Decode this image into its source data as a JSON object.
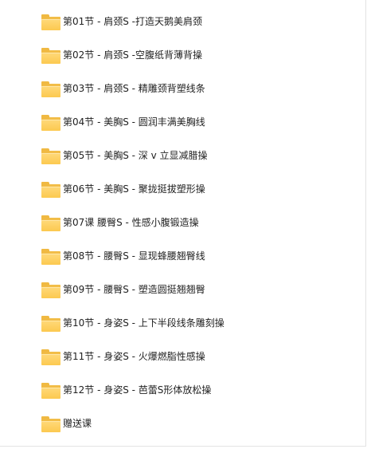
{
  "folders": [
    {
      "label": "第01节 - 肩颈S -打造天鹅美肩颈",
      "icon": "folder-icon"
    },
    {
      "label": "第02节 - 肩颈S -空腹纸背薄背操",
      "icon": "folder-icon"
    },
    {
      "label": "第03节 - 肩颈S - 精雕颈背塑线条",
      "icon": "folder-icon"
    },
    {
      "label": "第04节 - 美胸S - 圆润丰满美胸线",
      "icon": "folder-icon"
    },
    {
      "label": "第05节 - 美胸S - 深 v 立显减腊操",
      "icon": "folder-icon"
    },
    {
      "label": "第06节 - 美胸S - 聚拢挺拔塑形操",
      "icon": "folder-icon"
    },
    {
      "label": "第07课 腰臀S - 性感小腹锻造操",
      "icon": "folder-icon"
    },
    {
      "label": "第08节 - 腰臀S - 显现蜂腰翘臀线",
      "icon": "folder-icon"
    },
    {
      "label": "第09节 - 腰臀S - 塑造圆挺翘翘臀",
      "icon": "folder-icon"
    },
    {
      "label": "第10节 - 身姿S - 上下半段线条雕刻操",
      "icon": "folder-icon"
    },
    {
      "label": "第11节 - 身姿S - 火爆燃脂性感操",
      "icon": "folder-icon"
    },
    {
      "label": "第12节 - 身姿S - 芭蕾S形体放松操",
      "icon": "folder-icon"
    },
    {
      "label": "赠送课",
      "icon": "folder-icon"
    }
  ],
  "colors": {
    "folder_front": "#fcc94f",
    "folder_back": "#f2bd48",
    "text": "#222222",
    "background": "#ffffff"
  }
}
